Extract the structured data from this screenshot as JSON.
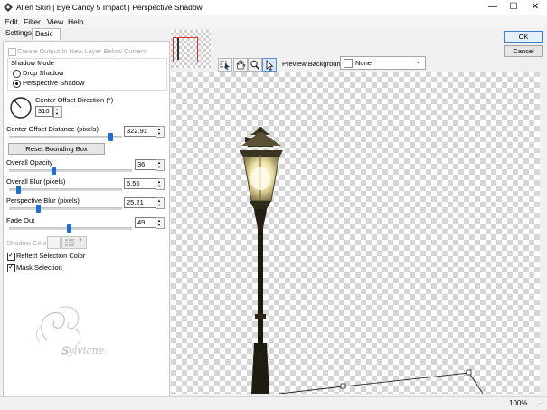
{
  "window": {
    "title": "Alien Skin | Eye Candy 5 Impact | Perspective Shadow",
    "minimize_glyph": "—",
    "maximize_glyph": "☐",
    "close_glyph": "✕"
  },
  "menu": [
    "Edit",
    "Filter",
    "View",
    "Help"
  ],
  "tabs": [
    {
      "label": "Settings",
      "active": false
    },
    {
      "label": "Basic",
      "active": true
    }
  ],
  "basic": {
    "create_output_label": "Create Output In New Layer Below Current",
    "create_output_checked": false,
    "shadow_mode_label": "Shadow Mode",
    "drop_shadow_label": "Drop Shadow",
    "perspective_shadow_label": "Perspective Shadow",
    "selected_mode": "Perspective Shadow",
    "direction_label": "Center Offset Direction (°)",
    "direction_value": "310",
    "distance_label": "Center Offset Distance (pixels)",
    "distance_value": "322.91",
    "distance_slider": 0.92,
    "reset_label": "Reset Bounding Box",
    "opacity_label": "Overall Opacity",
    "opacity_value": "36",
    "opacity_slider": 0.36,
    "blur_label": "Overall Blur (pixels)",
    "blur_value": "6.56",
    "blur_slider": 0.07,
    "pblur_label": "Perspective Blur (pixels)",
    "pblur_value": "25.21",
    "pblur_slider": 0.25,
    "fade_label": "Fade Out",
    "fade_value": "49",
    "fade_slider": 0.49,
    "shadow_color_label": "Shadow Color",
    "reflect_label": "Reflect Selection Color",
    "reflect_checked": true,
    "mask_label": "Mask Selection",
    "mask_checked": true
  },
  "watermark": "Sylviane",
  "buttons": {
    "ok": "OK",
    "cancel": "Cancel"
  },
  "preview": {
    "background_label": "Preview Background:",
    "background_value": "None",
    "zoom": "100%"
  },
  "colors": {
    "accent": "#1f6fd1",
    "thumbnail_frame": "#e03030"
  },
  "icons": [
    "app-icon",
    "select-tool-icon",
    "hand-tool-icon",
    "zoom-tool-icon",
    "pointer-tool-icon",
    "dropdown-arrow-icon"
  ]
}
